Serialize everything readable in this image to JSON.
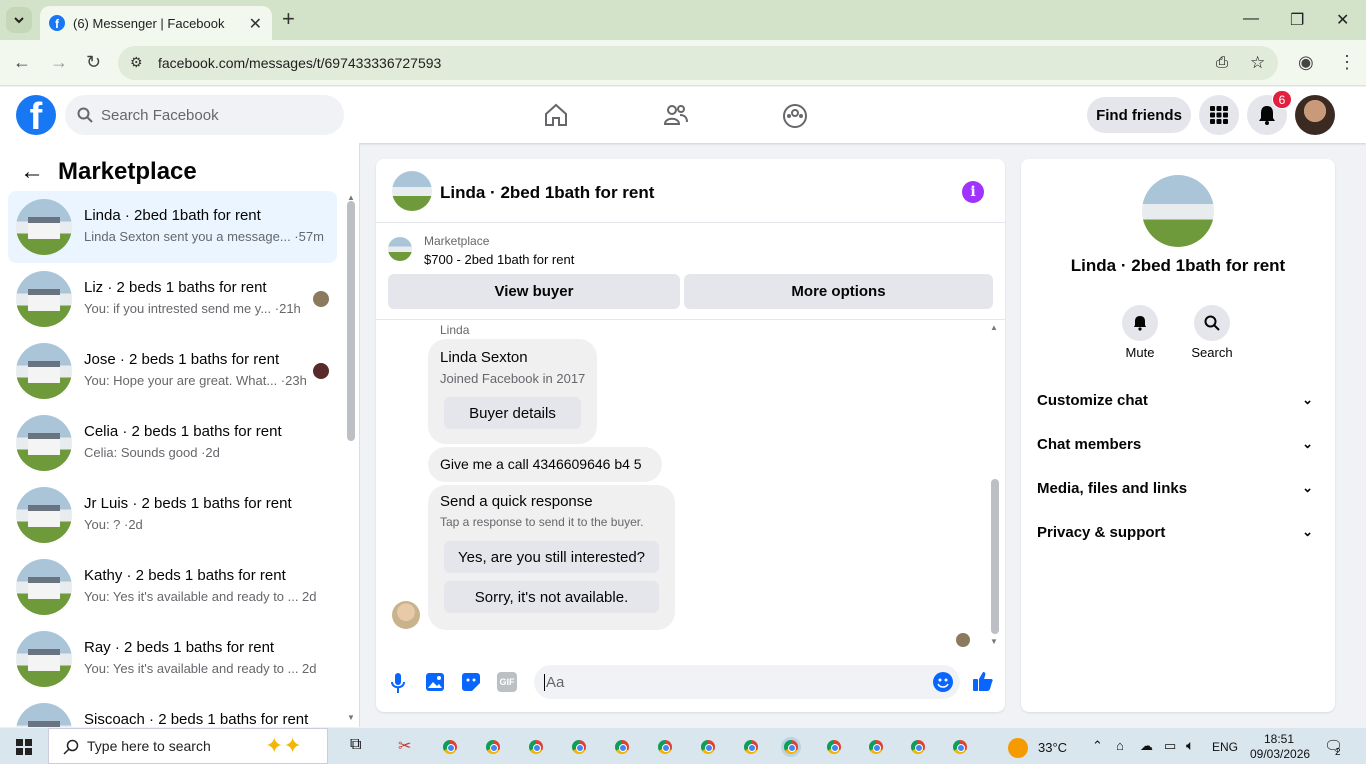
{
  "browser": {
    "tab_title": "(6) Messenger | Facebook",
    "url": "facebook.com/messages/t/697433336727593"
  },
  "fb_header": {
    "search_placeholder": "Search Facebook",
    "find_friends": "Find friends",
    "notification_count": "6"
  },
  "sidebar": {
    "title": "Marketplace",
    "conversations": [
      {
        "title": "Linda · 2bed 1bath for rent",
        "preview": "Linda Sexton sent you a message... ·57m",
        "time": ""
      },
      {
        "title": "Liz · 2 beds 1 baths for rent",
        "preview": "You: if you intrested send me y... ·21h",
        "time": ""
      },
      {
        "title": "Jose · 2 beds 1 baths for rent",
        "preview": "You: Hope your are great. What... ·23h",
        "time": ""
      },
      {
        "title": "Celia · 2 beds 1 baths for rent",
        "preview": "Celia: Sounds good ·2d",
        "time": ""
      },
      {
        "title": "Jr Luis · 2 beds 1 baths for rent",
        "preview": "You: ? ·2d",
        "time": ""
      },
      {
        "title": "Kathy · 2 beds 1 baths for rent",
        "preview": "You: Yes it's available and ready to ...",
        "time": "2d"
      },
      {
        "title": "Ray · 2 beds 1 baths for rent",
        "preview": "You: Yes it's available and ready to ...",
        "time": "2d"
      },
      {
        "title": "Siscoach · 2 beds 1 baths for rent",
        "preview": "",
        "time": ""
      }
    ]
  },
  "chat": {
    "title": "Linda · 2bed 1bath for rent",
    "listing_label": "Marketplace",
    "listing_price": "$700 - 2bed 1bath for rent",
    "view_buyer": "View buyer",
    "more_options": "More options",
    "sender_name": "Linda",
    "profile_name": "Linda Sexton",
    "profile_joined": "Joined Facebook in 2017",
    "buyer_details": "Buyer details",
    "message": "Give me a call 4346609646 b4 5",
    "quick_title": "Send a quick response",
    "quick_sub": "Tap a response to send it to the buyer.",
    "quick_1": "Yes, are you still interested?",
    "quick_2": "Sorry, it's not available.",
    "input_placeholder": "Aa",
    "gif_label": "GIF"
  },
  "details": {
    "name": "Linda · 2bed 1bath for rent",
    "mute": "Mute",
    "search": "Search",
    "sections": [
      "Customize chat",
      "Chat members",
      "Media, files and links",
      "Privacy & support"
    ]
  },
  "taskbar": {
    "search_placeholder": "Type here to search",
    "weather": "33°C",
    "language": "ENG",
    "time": "18:51",
    "date": "09/03/2026",
    "notif_count": "2"
  }
}
